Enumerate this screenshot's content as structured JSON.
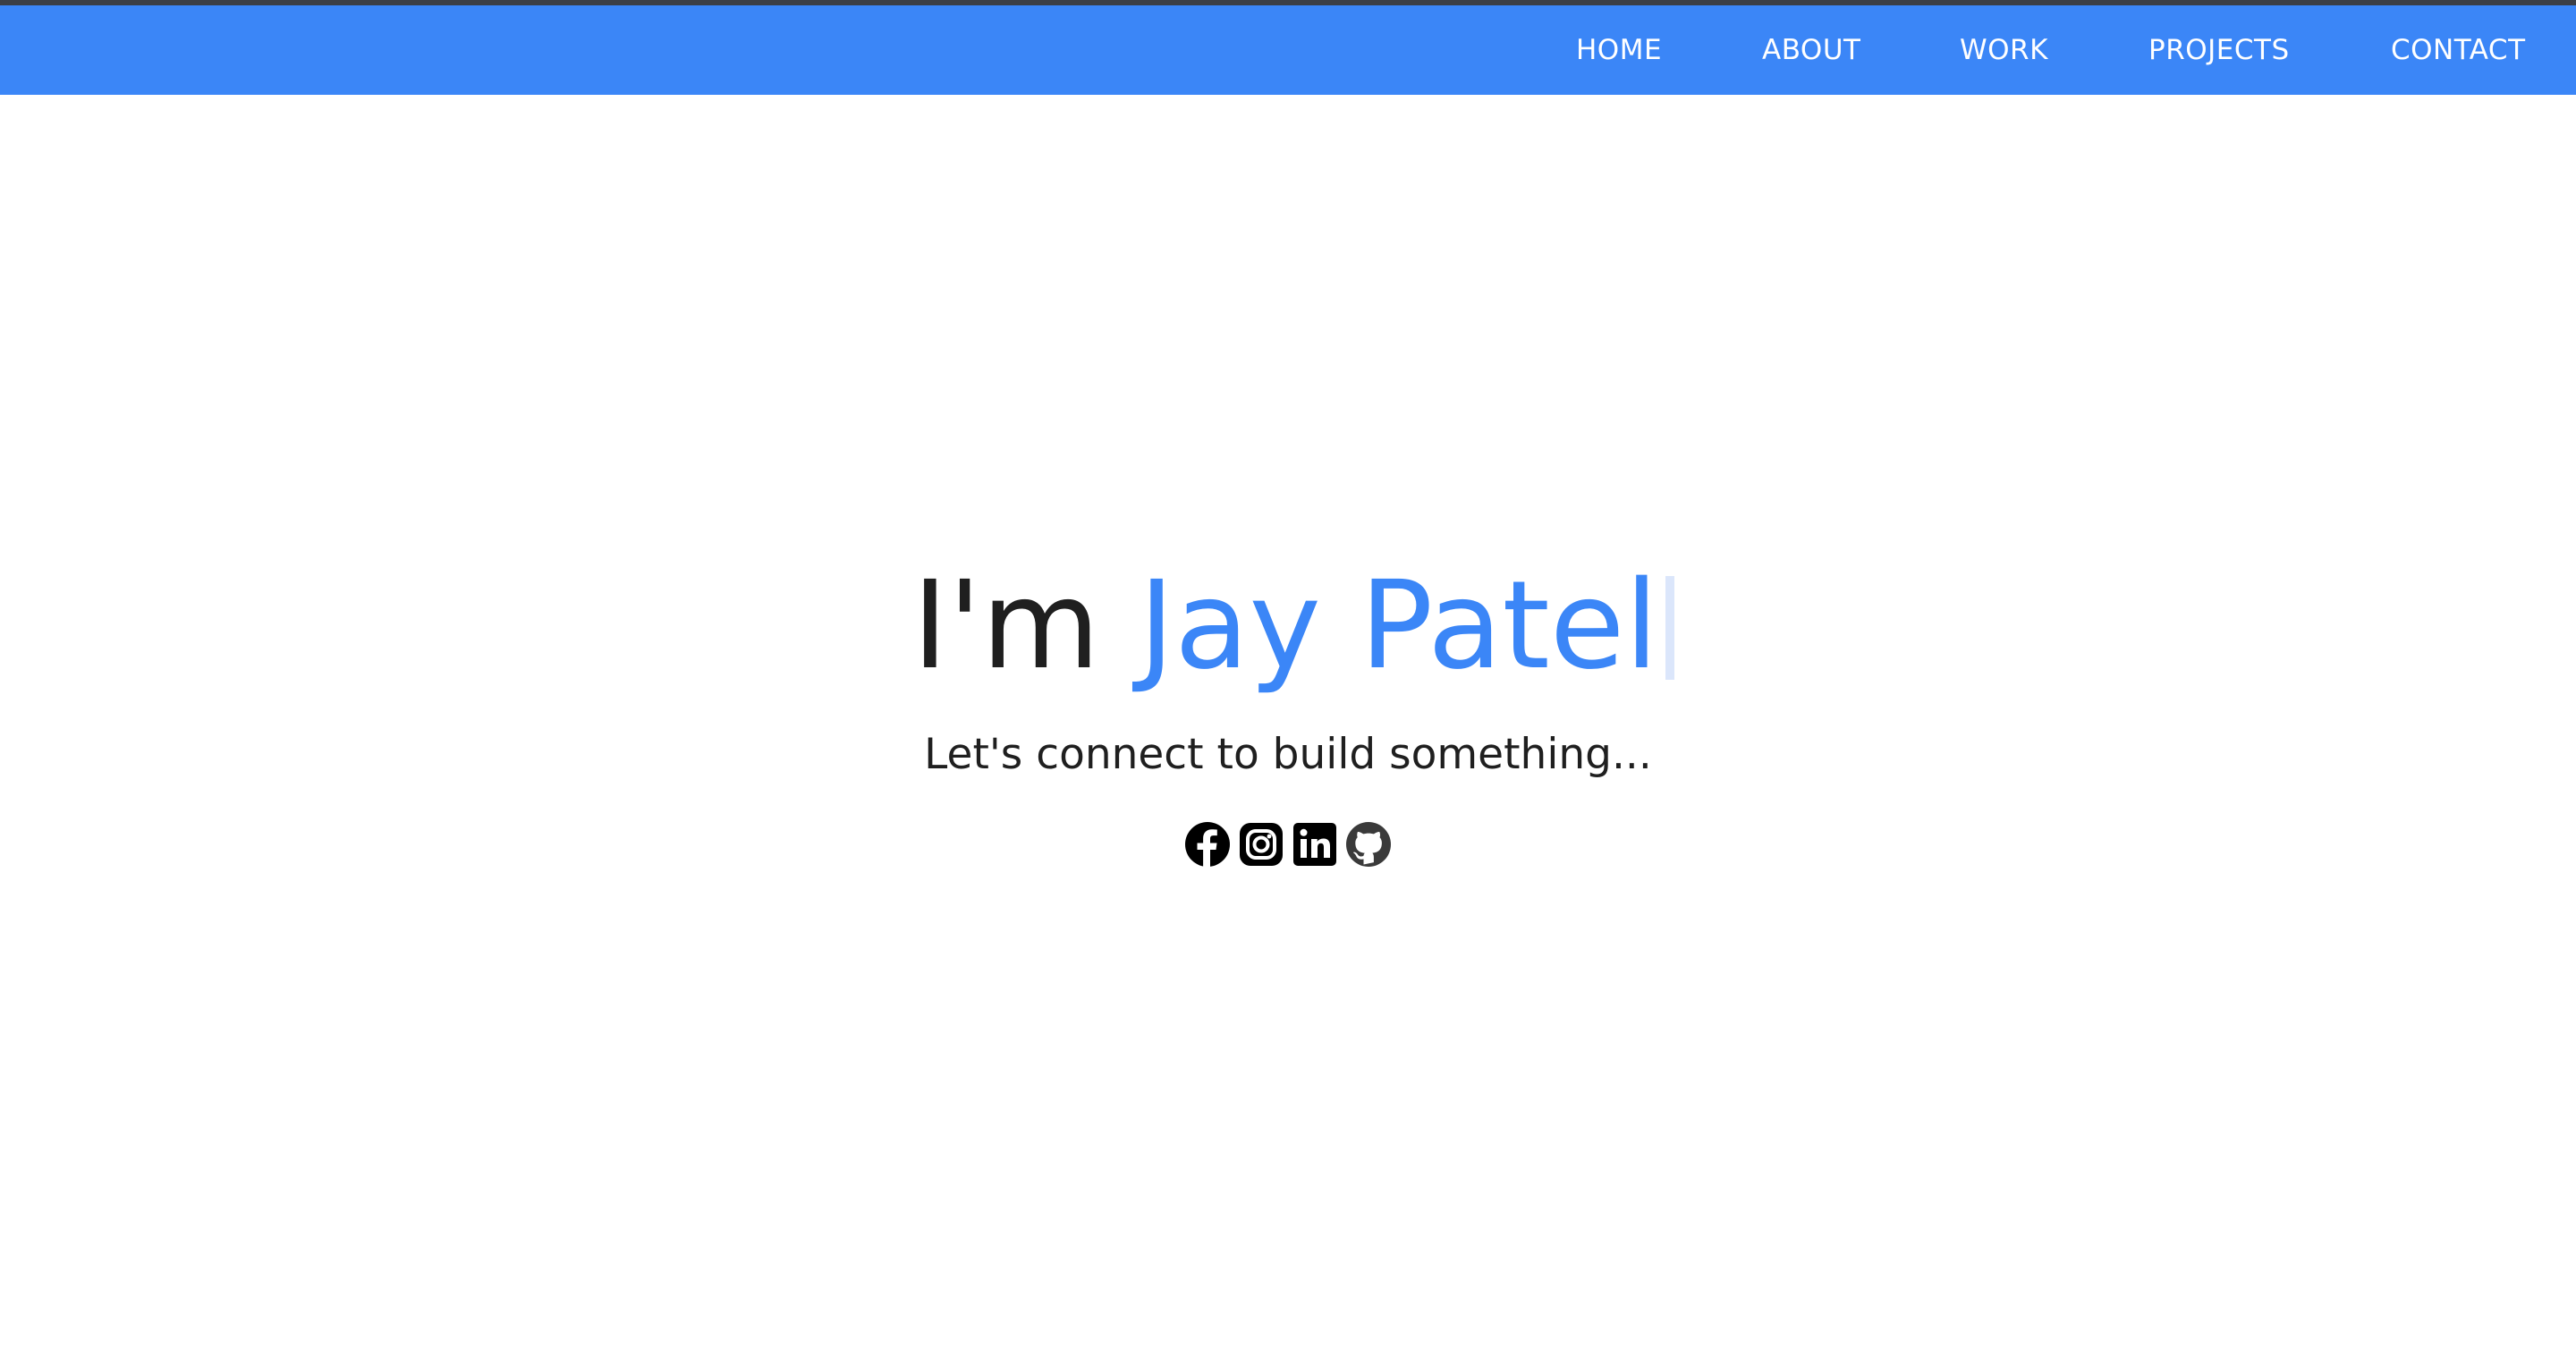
{
  "nav": {
    "items": [
      {
        "label": "HOME"
      },
      {
        "label": "ABOUT"
      },
      {
        "label": "WORK"
      },
      {
        "label": "PROJECTS"
      },
      {
        "label": "CONTACT"
      }
    ]
  },
  "hero": {
    "prefix": "I'm ",
    "name": "Jay Patel",
    "tagline": "Let's connect to build something..."
  },
  "socials": [
    {
      "icon": "facebook-icon"
    },
    {
      "icon": "instagram-icon"
    },
    {
      "icon": "linkedin-icon"
    },
    {
      "icon": "github-icon"
    }
  ],
  "colors": {
    "accent": "#3b86f7",
    "text": "#1f1f1f",
    "top_strip": "#3b3f46",
    "icon": "#000000"
  }
}
